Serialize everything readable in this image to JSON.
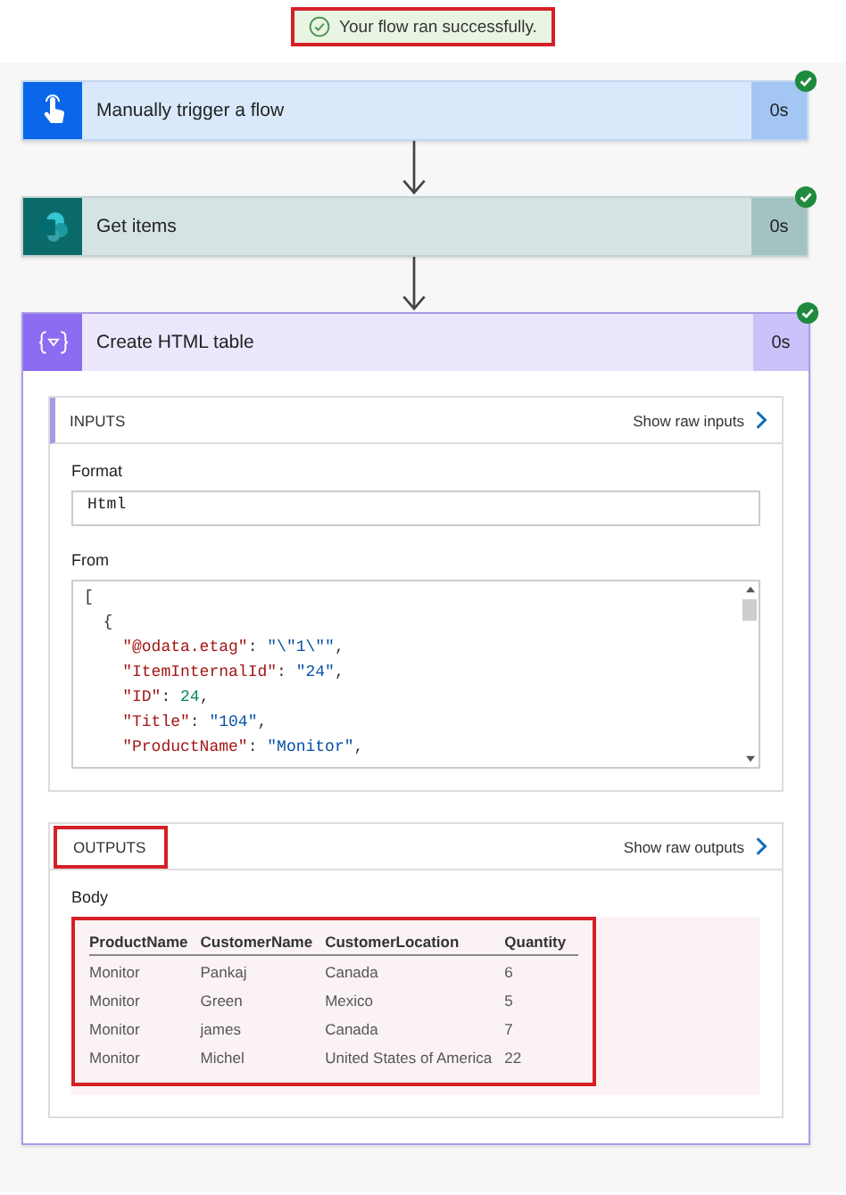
{
  "banner": {
    "text": "Your flow ran successfully."
  },
  "steps": [
    {
      "kind": "trigger",
      "title": "Manually trigger a flow",
      "duration": "0s",
      "succeeded": true
    },
    {
      "kind": "sharepoint",
      "title": "Get items",
      "duration": "0s",
      "succeeded": true
    },
    {
      "kind": "html",
      "title": "Create HTML table",
      "duration": "0s",
      "succeeded": true
    }
  ],
  "inputs": {
    "heading": "INPUTS",
    "link": "Show raw inputs",
    "format_label": "Format",
    "format_value": "Html",
    "from_label": "From",
    "code_lines": [
      [
        {
          "kind": "punct",
          "text": "["
        }
      ],
      [
        {
          "kind": "punct",
          "text": "  {"
        }
      ],
      [
        {
          "kind": "key",
          "text": "    \"@odata.etag\""
        },
        {
          "kind": "punct",
          "text": ": "
        },
        {
          "kind": "string",
          "text": "\"\\\"1\\\"\""
        },
        {
          "kind": "punct",
          "text": ","
        }
      ],
      [
        {
          "kind": "key",
          "text": "    \"ItemInternalId\""
        },
        {
          "kind": "punct",
          "text": ": "
        },
        {
          "kind": "string",
          "text": "\"24\""
        },
        {
          "kind": "punct",
          "text": ","
        }
      ],
      [
        {
          "kind": "key",
          "text": "    \"ID\""
        },
        {
          "kind": "punct",
          "text": ": "
        },
        {
          "kind": "number",
          "text": "24"
        },
        {
          "kind": "punct",
          "text": ","
        }
      ],
      [
        {
          "kind": "key",
          "text": "    \"Title\""
        },
        {
          "kind": "punct",
          "text": ": "
        },
        {
          "kind": "string",
          "text": "\"104\""
        },
        {
          "kind": "punct",
          "text": ","
        }
      ],
      [
        {
          "kind": "key",
          "text": "    \"ProductName\""
        },
        {
          "kind": "punct",
          "text": ": "
        },
        {
          "kind": "string",
          "text": "\"Monitor\""
        },
        {
          "kind": "punct",
          "text": ","
        }
      ]
    ]
  },
  "outputs": {
    "heading": "OUTPUTS",
    "link": "Show raw outputs",
    "body_label": "Body",
    "table": {
      "columns": [
        "ProductName",
        "CustomerName",
        "CustomerLocation",
        "Quantity"
      ],
      "rows": [
        [
          "Monitor",
          "Pankaj",
          "Canada",
          "6"
        ],
        [
          "Monitor",
          "Green",
          "Mexico",
          "5"
        ],
        [
          "Monitor",
          "james",
          "Canada",
          "7"
        ],
        [
          "Monitor",
          "Michel",
          "United States of America",
          "22"
        ]
      ]
    }
  }
}
